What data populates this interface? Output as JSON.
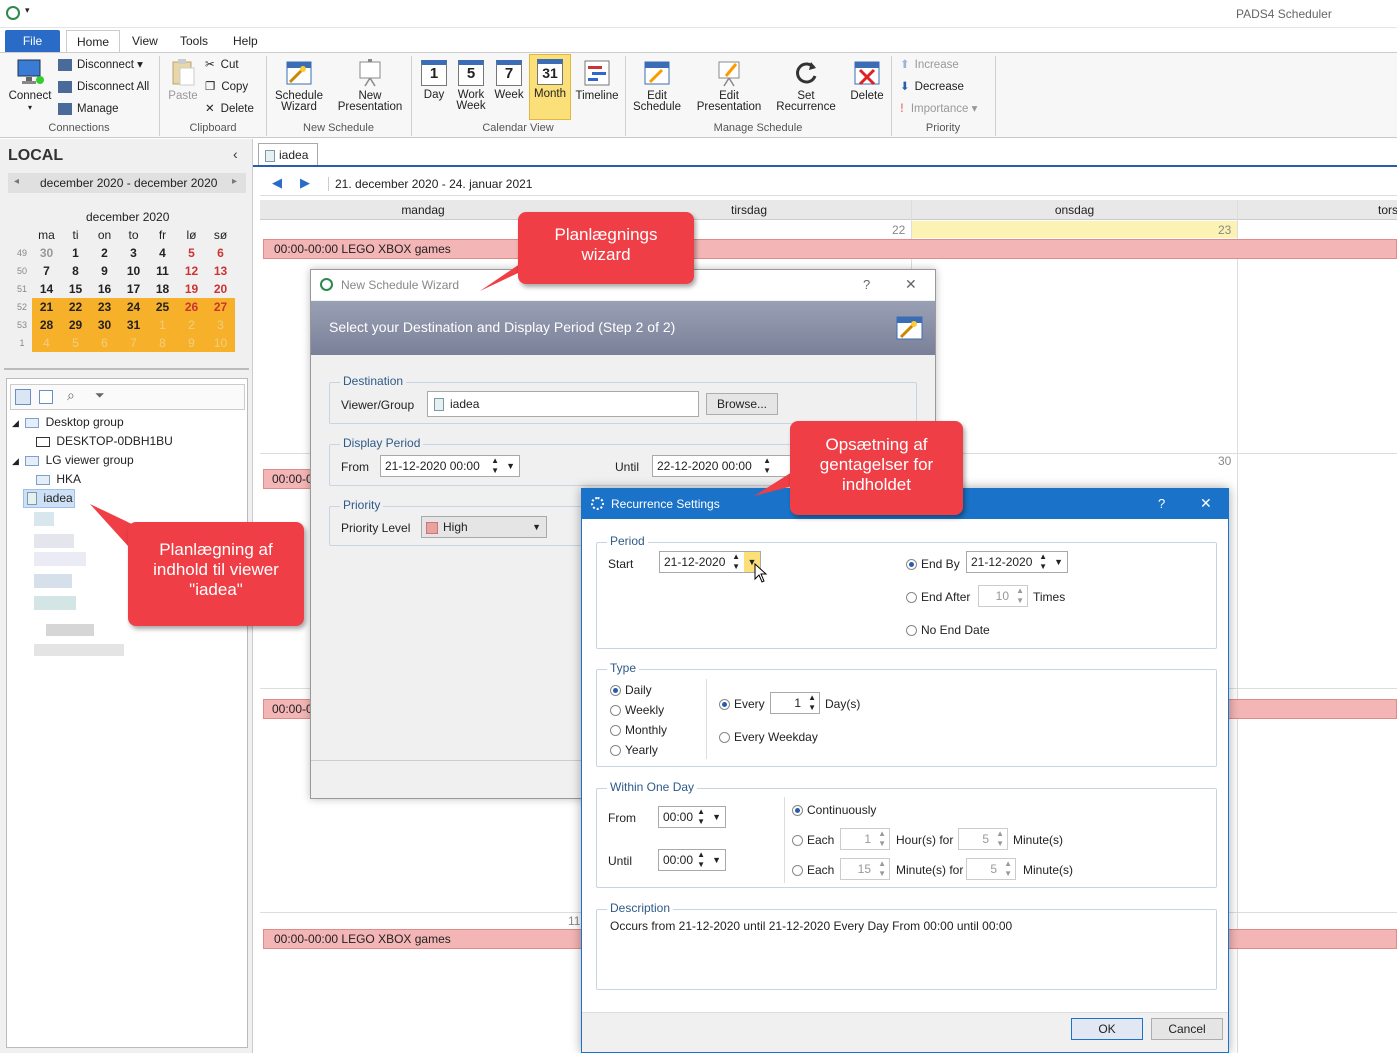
{
  "app": {
    "title": "PADS4 Scheduler"
  },
  "menu": {
    "file": "File",
    "home": "Home",
    "view": "View",
    "tools": "Tools",
    "help": "Help"
  },
  "ribbon": {
    "connect": "Connect",
    "disconnect": "Disconnect",
    "disconnect_all": "Disconnect All",
    "manage": "Manage",
    "connections": "Connections",
    "paste": "Paste",
    "cut": "Cut",
    "copy": "Copy",
    "delete": "Delete",
    "clipboard": "Clipboard",
    "schedule_wizard": [
      "Schedule",
      "Wizard"
    ],
    "new_presentation": [
      "New",
      "Presentation"
    ],
    "new_schedule": "New Schedule",
    "day": "Day",
    "work_week": [
      "Work",
      "Week"
    ],
    "week": "Week",
    "month": "Month",
    "timeline": "Timeline",
    "calendar_view": "Calendar View",
    "edit_schedule": [
      "Edit",
      "Schedule"
    ],
    "edit_presentation": [
      "Edit",
      "Presentation"
    ],
    "set_recurrence": [
      "Set",
      "Recurrence"
    ],
    "delete_btn": "Delete",
    "manage_schedule": "Manage Schedule",
    "increase": "Increase",
    "decrease": "Decrease",
    "importance": "Importance",
    "priority": "Priority",
    "icons": {
      "day": "1",
      "work_week": "5",
      "week": "7",
      "month": "31"
    }
  },
  "left": {
    "title": "LOCAL",
    "range": "december 2020 - december 2020",
    "month_title": "december 2020",
    "weekdays": [
      "ma",
      "ti",
      "on",
      "to",
      "fr",
      "lø",
      "sø"
    ],
    "weeks": [
      {
        "wk": "49",
        "days": [
          "30",
          "1",
          "2",
          "3",
          "4",
          "5",
          "6"
        ]
      },
      {
        "wk": "50",
        "days": [
          "7",
          "8",
          "9",
          "10",
          "11",
          "12",
          "13"
        ]
      },
      {
        "wk": "51",
        "days": [
          "14",
          "15",
          "16",
          "17",
          "18",
          "19",
          "20"
        ]
      },
      {
        "wk": "52",
        "days": [
          "21",
          "22",
          "23",
          "24",
          "25",
          "26",
          "27"
        ]
      },
      {
        "wk": "53",
        "days": [
          "28",
          "29",
          "30",
          "31",
          "1",
          "2",
          "3"
        ]
      },
      {
        "wk": "1",
        "days": [
          "4",
          "5",
          "6",
          "7",
          "8",
          "9",
          "10"
        ]
      }
    ],
    "tree": {
      "desktop_group": "Desktop group",
      "desktop_pc": "DESKTOP-0DBH1BU",
      "lg_group": "LG viewer group",
      "hka": "HKA",
      "iadea": "iadea"
    }
  },
  "main": {
    "tab": "iadea",
    "range": "21. december 2020 - 24. januar 2021",
    "days": [
      "mandag",
      "tirsdag",
      "onsdag",
      "tors"
    ],
    "nums": {
      "n22": "22",
      "n23": "23",
      "n30": "30",
      "n11": "11"
    },
    "event": "00:00-00:00 LEGO XBOX games",
    "event_short": "00:00-0"
  },
  "wizard": {
    "title": "New Schedule Wizard",
    "help": "?",
    "close": "✕",
    "step": "Select your Destination and Display Period (Step 2 of 2)",
    "destination": "Destination",
    "viewer_group": "Viewer/Group",
    "viewer_value": "iadea",
    "browse": "Browse...",
    "display_period": "Display Period",
    "from": "From",
    "from_value": "21-12-2020 00:00",
    "until": "Until",
    "until_value": "22-12-2020 00:00",
    "priority": "Priority",
    "priority_level": "Priority Level",
    "priority_value": "High"
  },
  "recurrence": {
    "title": "Recurrence Settings",
    "help": "?",
    "close": "✕",
    "period": "Period",
    "start": "Start",
    "start_value": "21-12-2020",
    "end_by": "End By",
    "end_by_value": "21-12-2020",
    "end_after": "End After",
    "end_after_value": "10",
    "times": "Times",
    "no_end": "No End Date",
    "type": "Type",
    "daily": "Daily",
    "weekly": "Weekly",
    "monthly": "Monthly",
    "yearly": "Yearly",
    "every": "Every",
    "every_value": "1",
    "days": "Day(s)",
    "every_weekday": "Every Weekday",
    "within": "Within One Day",
    "from": "From",
    "from_value": "00:00",
    "until": "Until",
    "until_value": "00:00",
    "continuously": "Continuously",
    "each1": "Each",
    "each1_value": "1",
    "hours_for": "Hour(s) for",
    "hours_for_value": "5",
    "minutes1": "Minute(s)",
    "each2": "Each",
    "each2_value": "15",
    "minutes_for": "Minute(s) for",
    "minutes_for_value": "5",
    "minutes2": "Minute(s)",
    "description": "Description",
    "desc_text": "Occurs from 21-12-2020 until 21-12-2020 Every Day From 00:00 until 00:00",
    "ok": "OK",
    "cancel": "Cancel"
  },
  "callouts": {
    "wizard": "Planlægnings wizard",
    "recurrence": "Opsætning af gentagelser for indholdet",
    "viewer": "Planlægning af indhold til viewer \"iadea\""
  },
  "colors": {
    "accent": "#2a5cab",
    "today": "#fcf2b3",
    "event": "#f3b5b5",
    "highlight": "#f6b02a",
    "callout": "#ef3e45"
  }
}
